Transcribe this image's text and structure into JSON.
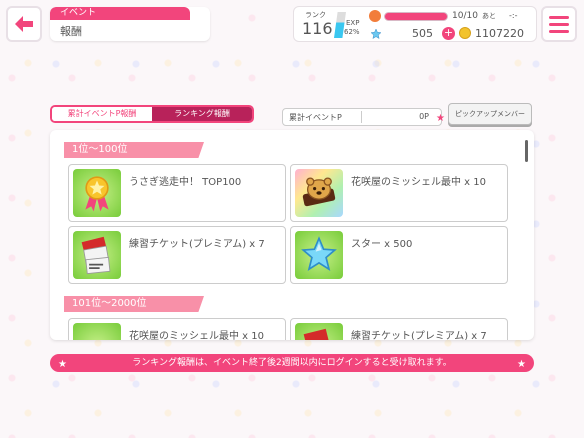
{
  "header": {
    "category": "イベント",
    "title": "報酬"
  },
  "status": {
    "rank_label": "ランク",
    "rank_value": "116",
    "exp_label": "EXP",
    "exp_percent": "62%",
    "lp_value": "10/10",
    "lp_after_label": "あと",
    "lp_timer": "-:-",
    "star_count": "505",
    "coin_count": "1107220",
    "plus_symbol": "+"
  },
  "tabs": {
    "cumulative_label": "累計イベントP報酬",
    "ranking_label": "ランキング報酬"
  },
  "event_points": {
    "label": "累計イベントP",
    "value": "0P"
  },
  "pickup_button_label": "ピックアップメンバー",
  "sections": [
    {
      "header": "1位〜100位",
      "rewards": [
        {
          "icon": "ribbon-medal-icon",
          "label": "うさぎ逃走中！ TOP100"
        },
        {
          "icon": "michel-pastry-icon",
          "label": "花咲屋のミッシェル最中 x 10"
        },
        {
          "icon": "practice-ticket-icon",
          "label": "練習チケット(プレミアム) x 7"
        },
        {
          "icon": "star-icon",
          "label": "スター x 500"
        }
      ]
    },
    {
      "header": "101位〜2000位",
      "rewards": [
        {
          "icon": "michel-pastry-icon",
          "label": "花咲屋のミッシェル最中 x 10"
        },
        {
          "icon": "practice-ticket-icon",
          "label": "練習チケット(プレミアム) x 7"
        }
      ]
    }
  ],
  "notice": "ランキング報酬は、イベント終了後2週間以内にログインすると受け取れます。",
  "colors": {
    "accent": "#f2457c",
    "tab_active": "#b8225a",
    "section_header": "#f890a8"
  }
}
